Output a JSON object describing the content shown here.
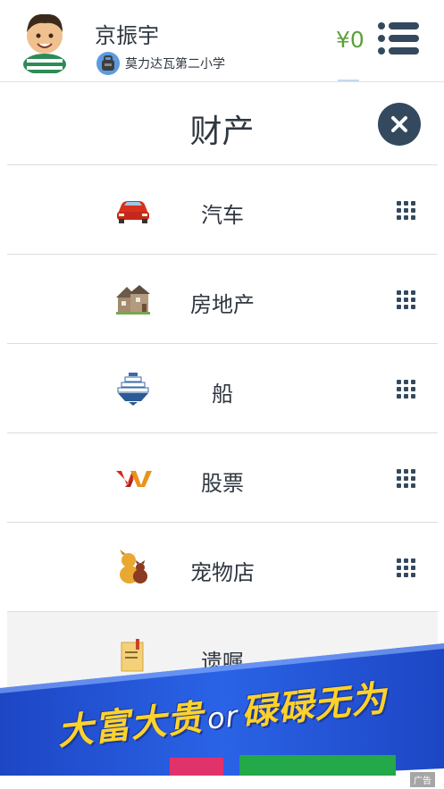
{
  "header": {
    "username": "京振宇",
    "school": "莫力达瓦第二小学",
    "money": "¥0"
  },
  "panel": {
    "title": "财产",
    "items": [
      {
        "label": "汽车",
        "icon": "car-icon"
      },
      {
        "label": "房地产",
        "icon": "house-icon"
      },
      {
        "label": "船",
        "icon": "ship-icon"
      },
      {
        "label": "股票",
        "icon": "stock-icon"
      },
      {
        "label": "宠物店",
        "icon": "pet-icon"
      },
      {
        "label": "遗嘱",
        "icon": "will-icon"
      }
    ]
  },
  "ad": {
    "text_a": "大富大贵",
    "text_or": "or",
    "text_b": "碌碌无为",
    "label": "广告"
  },
  "colors": {
    "money": "#5aa13a",
    "close_button": "#34495e",
    "banner": "#2156d6",
    "ad_text": "#ffd22b"
  }
}
